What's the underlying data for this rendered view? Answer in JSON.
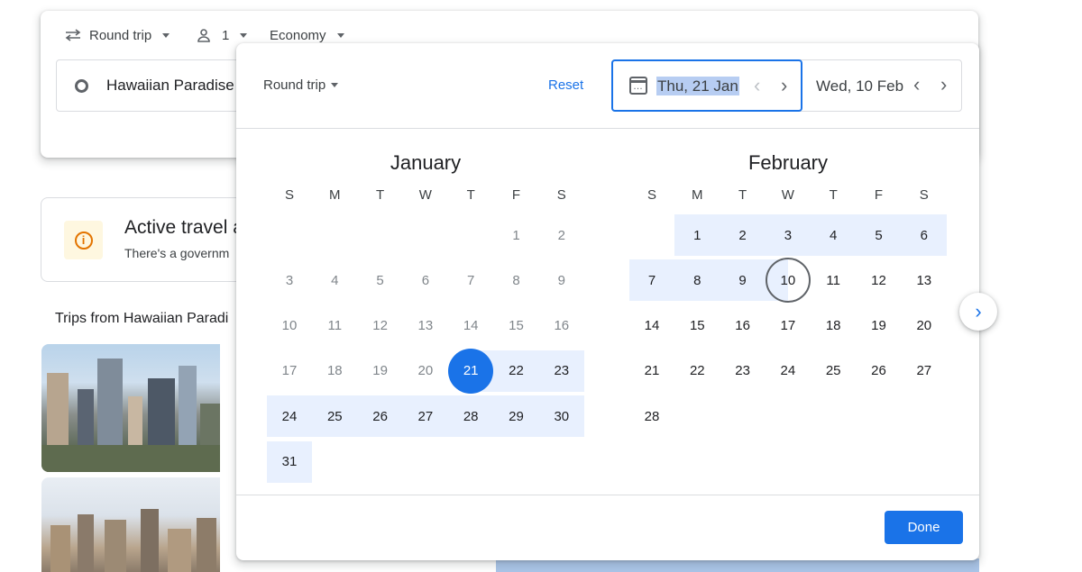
{
  "search": {
    "trip_type": "Round trip",
    "passengers": "1",
    "cabin": "Economy",
    "origin": "Hawaiian Paradise"
  },
  "advisory": {
    "title": "Active travel a",
    "subtitle": "There's a governm"
  },
  "trips_heading": "Trips from Hawaiian Paradi",
  "picker": {
    "trip_type": "Round trip",
    "reset_label": "Reset",
    "departure": "Thu, 21 Jan",
    "return": "Wed, 10 Feb",
    "prev_icon": "chevron-left-icon",
    "next_icon": "chevron-right-icon",
    "done_label": "Done"
  },
  "weekdays": [
    "S",
    "M",
    "T",
    "W",
    "T",
    "F",
    "S"
  ],
  "months": [
    {
      "name": "January",
      "first_weekday": 5,
      "days": 31,
      "past_until": 20,
      "selected_start": 21,
      "range_until": 31
    },
    {
      "name": "February",
      "first_weekday": 1,
      "days": 28,
      "range_until": 10,
      "selected_end": 10
    }
  ],
  "colors": {
    "accent": "#1a73e8",
    "range": "#e8f0fe",
    "selection_highlight": "#b7cdf2"
  }
}
